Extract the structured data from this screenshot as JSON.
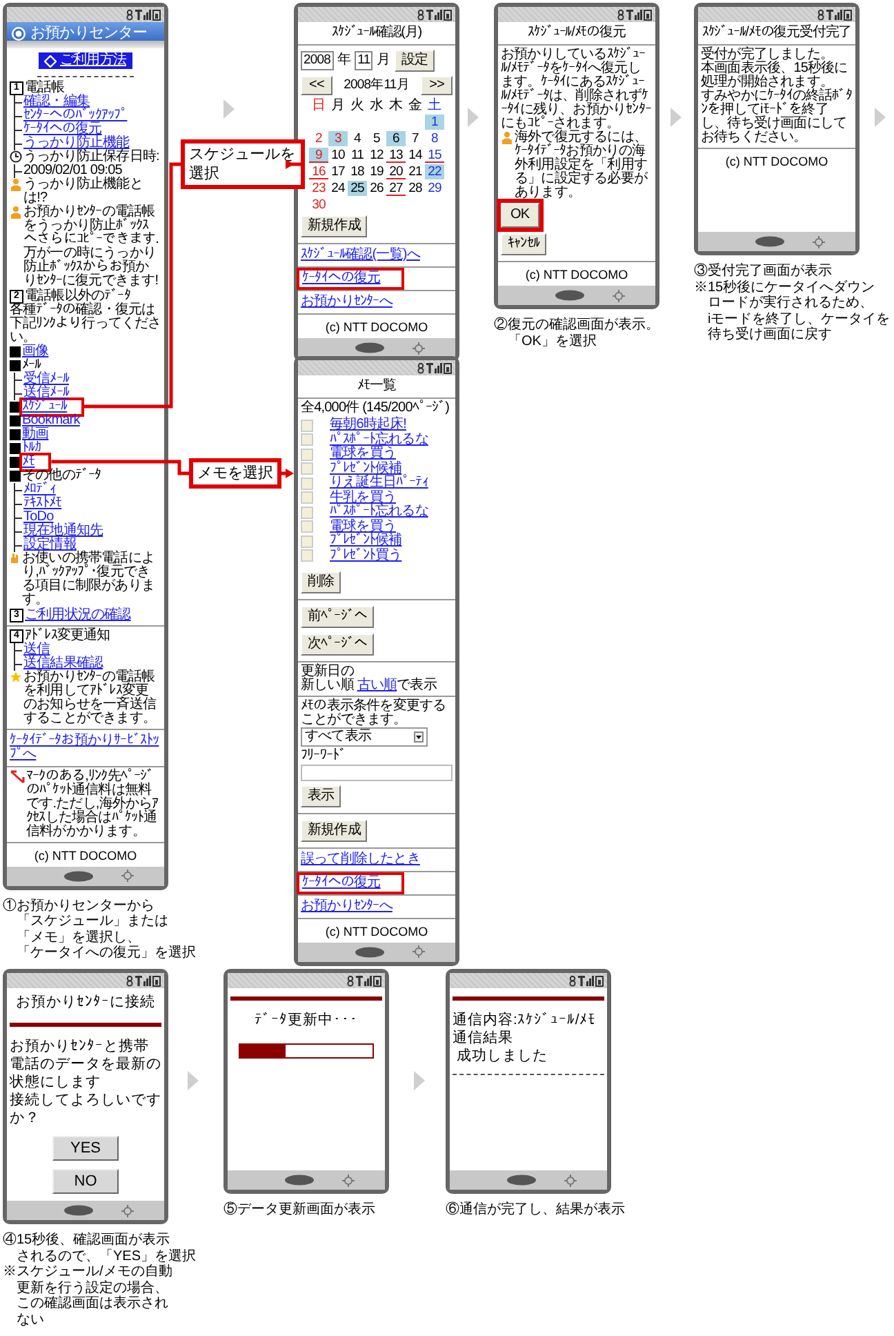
{
  "screens": [
    {
      "blocks": [
        {
          "kind": "title_bar",
          "text": "お預かりセンター"
        },
        {
          "kind": "help_link",
          "text": "ご利用方法"
        },
        {
          "kind": "dashes"
        },
        {
          "kind": "section",
          "num": "1",
          "text": "電話帳",
          "link": false
        },
        {
          "kind": "tree",
          "items": [
            {
              "text": "確認・編集",
              "link": true
            },
            {
              "text": "ｾﾝﾀｰへのﾊﾞｯｸｱｯﾌﾟ",
              "link": true
            },
            {
              "text": "ｹｰﾀｲへの復元",
              "link": true
            },
            {
              "text": "うっかり防止機能",
              "link": true
            }
          ]
        },
        {
          "kind": "clock_note",
          "text": "うっかり防止保存日時:"
        },
        {
          "kind": "tree",
          "items": [
            {
              "text": "2009/02/01 09:05",
              "link": false
            }
          ]
        },
        {
          "kind": "person_note",
          "text": "うっかり防止機能とは!?"
        },
        {
          "kind": "key_note",
          "text": "お預かりｾﾝﾀｰの電話帳をうっかり防止ﾎﾞｯｸｽへさらにｺﾋﾟｰできます.万が一の時にうっかり防止ﾎﾞｯｸｽからお預かりｾﾝﾀｰに復元できます!"
        },
        {
          "kind": "section",
          "num": "2",
          "text": "電話帳以外のﾃﾞｰﾀ",
          "link": false
        },
        {
          "kind": "text",
          "text": "各種ﾃﾞｰﾀの確認・復元は下記ﾘﾝｸより行ってください。"
        },
        {
          "kind": "bullet",
          "text": "画像",
          "link": true,
          "highlighted": false
        },
        {
          "kind": "bullet",
          "text": "ﾒｰﾙ",
          "link": false,
          "highlighted": false
        },
        {
          "kind": "tree",
          "items": [
            {
              "text": "受信ﾒｰﾙ",
              "link": true
            },
            {
              "text": "送信ﾒｰﾙ",
              "link": true
            }
          ]
        },
        {
          "kind": "bullet",
          "text": "ｽｹｼﾞｭｰﾙ",
          "link": true,
          "highlighted": true
        },
        {
          "kind": "bullet",
          "text": "Bookmark",
          "link": true,
          "highlighted": false
        },
        {
          "kind": "bullet",
          "text": "動画",
          "link": true,
          "highlighted": false
        },
        {
          "kind": "bullet",
          "text": "ﾄﾙｶ",
          "link": true,
          "highlighted": false
        },
        {
          "kind": "bullet",
          "text": "ﾒﾓ",
          "link": true,
          "highlighted": true
        },
        {
          "kind": "bullet",
          "text": "その他のﾃﾞｰﾀ",
          "link": false,
          "highlighted": false
        },
        {
          "kind": "tree",
          "items": [
            {
              "text": "ﾒﾛﾃﾞｨ",
              "link": true
            },
            {
              "text": "ﾃｷｽﾄﾒﾓ",
              "link": true
            },
            {
              "text": "ToDo",
              "link": true
            },
            {
              "text": "現在地通知先",
              "link": true
            },
            {
              "text": "設定情報",
              "link": true
            }
          ]
        },
        {
          "kind": "hand_note",
          "text": "お使いの携帯電話により,ﾊﾞｯｸｱｯﾌﾟ･復元できる項目に制限があります。"
        },
        {
          "kind": "section",
          "num": "3",
          "text": "ご利用状況の確認",
          "link": true
        },
        {
          "kind": "divider"
        },
        {
          "kind": "section",
          "num": "4",
          "text": "ｱﾄﾞﾚｽ変更通知",
          "link": false
        },
        {
          "kind": "tree",
          "items": [
            {
              "text": "送信",
              "link": true
            },
            {
              "text": "送信結果確認",
              "link": true
            }
          ]
        },
        {
          "kind": "star_note",
          "text": "お預かりｾﾝﾀｰの電話帳を利用してｱﾄﾞﾚｽ変更のお知らせを一斉送信することができます。"
        },
        {
          "kind": "divider"
        },
        {
          "kind": "link",
          "text": "ｹｰﾀｲﾃﾞｰﾀお預かりｻｰﾋﾞｽﾄｯﾌﾟへ",
          "highlighted": false
        },
        {
          "kind": "divider"
        },
        {
          "kind": "free_note",
          "text": "ﾏｰｸのある,ﾘﾝｸ先ﾍﾟｰｼﾞのﾊﾟｹｯﾄ通信料は無料です.ただし,海外からｱｸｾｽした場合はﾊﾟｹｯﾄ通信料がかかります。"
        },
        {
          "kind": "divider"
        },
        {
          "kind": "footer",
          "text": "(c) NTT DOCOMO"
        }
      ],
      "caption": [
        [
          "①お預かりセンターから",
          "「スケジュール」または",
          "「メモ」を選択し、",
          "「ケータイへの復元」を選択"
        ]
      ]
    },
    {
      "blocks": [
        {
          "kind": "heading",
          "text": "ｽｹｼﾞｭｰﾙ確認(月)"
        },
        {
          "kind": "calendar",
          "year": "2008",
          "year_unit": "年",
          "month": "11",
          "month_unit": "月",
          "set_button": "設定",
          "prev": "<<",
          "next": ">>",
          "caption": "2008年11月",
          "weekdays": [
            "日",
            "月",
            "火",
            "水",
            "木",
            "金",
            "土"
          ],
          "days": [
            {
              "day": "1",
              "marked": true,
              "underlined": false,
              "holiday": false
            },
            {
              "day": "2",
              "marked": false,
              "underlined": false,
              "holiday": true
            },
            {
              "day": "3",
              "marked": true,
              "underlined": false,
              "holiday": true
            },
            {
              "day": "4",
              "marked": false,
              "underlined": false,
              "holiday": false
            },
            {
              "day": "5",
              "marked": false,
              "underlined": false,
              "holiday": false
            },
            {
              "day": "6",
              "marked": true,
              "underlined": false,
              "holiday": false
            },
            {
              "day": "7",
              "marked": false,
              "underlined": false,
              "holiday": false
            },
            {
              "day": "8",
              "marked": false,
              "underlined": false,
              "holiday": false
            },
            {
              "day": "9",
              "marked": true,
              "underlined": true,
              "holiday": true
            },
            {
              "day": "10",
              "marked": false,
              "underlined": false,
              "holiday": false
            },
            {
              "day": "11",
              "marked": false,
              "underlined": false,
              "holiday": false
            },
            {
              "day": "12",
              "marked": false,
              "underlined": false,
              "holiday": false
            },
            {
              "day": "13",
              "marked": false,
              "underlined": true,
              "holiday": false
            },
            {
              "day": "14",
              "marked": false,
              "underlined": false,
              "holiday": false
            },
            {
              "day": "15",
              "marked": false,
              "underlined": true,
              "holiday": false
            },
            {
              "day": "16",
              "marked": false,
              "underlined": true,
              "holiday": true
            },
            {
              "day": "17",
              "marked": false,
              "underlined": false,
              "holiday": false
            },
            {
              "day": "18",
              "marked": false,
              "underlined": false,
              "holiday": false
            },
            {
              "day": "19",
              "marked": false,
              "underlined": false,
              "holiday": false
            },
            {
              "day": "20",
              "marked": false,
              "underlined": true,
              "holiday": false
            },
            {
              "day": "21",
              "marked": false,
              "underlined": false,
              "holiday": false
            },
            {
              "day": "22",
              "marked": true,
              "underlined": false,
              "holiday": false
            },
            {
              "day": "23",
              "marked": false,
              "underlined": false,
              "holiday": true
            },
            {
              "day": "24",
              "marked": false,
              "underlined": false,
              "holiday": false
            },
            {
              "day": "25",
              "marked": true,
              "underlined": false,
              "holiday": false
            },
            {
              "day": "26",
              "marked": false,
              "underlined": false,
              "holiday": false
            },
            {
              "day": "27",
              "marked": false,
              "underlined": true,
              "holiday": false
            },
            {
              "day": "28",
              "marked": false,
              "underlined": false,
              "holiday": false
            },
            {
              "day": "29",
              "marked": false,
              "underlined": false,
              "holiday": false
            },
            {
              "day": "30",
              "marked": false,
              "underlined": false,
              "holiday": true
            }
          ]
        },
        {
          "kind": "button",
          "text": "新規作成",
          "highlighted": false
        },
        {
          "kind": "divider"
        },
        {
          "kind": "link",
          "text": "ｽｹｼﾞｭｰﾙ確認(一覧)へ",
          "highlighted": false
        },
        {
          "kind": "divider"
        },
        {
          "kind": "link",
          "text": "ｹｰﾀｲへの復元",
          "highlighted": true
        },
        {
          "kind": "divider"
        },
        {
          "kind": "link",
          "text": "お預かりｾﾝﾀｰへ",
          "highlighted": false
        },
        {
          "kind": "divider"
        },
        {
          "kind": "footer",
          "text": "(c) NTT DOCOMO"
        }
      ]
    },
    {
      "blocks": [
        {
          "kind": "heading",
          "text": "ﾒﾓ一覧"
        },
        {
          "kind": "text",
          "text": "全4,000件 (145/200ﾍﾟｰｼﾞ)"
        },
        {
          "kind": "checklist",
          "items": [
            {
              "text": "毎朝6時起床!",
              "checked": false
            },
            {
              "text": "ﾊﾟｽﾎﾟｰﾄ忘れるな",
              "checked": false
            },
            {
              "text": "電球を買う",
              "checked": false
            },
            {
              "text": "ﾌﾟﾚｾﾞﾝﾄ候補",
              "checked": false
            },
            {
              "text": "りえ誕生日ﾊﾟｰﾃｨ",
              "checked": false
            },
            {
              "text": "牛乳を買う",
              "checked": false
            },
            {
              "text": "ﾊﾟｽﾎﾟｰﾄ忘れるな",
              "checked": false
            },
            {
              "text": "電球を買う",
              "checked": false
            },
            {
              "text": "ﾌﾟﾚｾﾞﾝﾄ候補",
              "checked": false
            },
            {
              "text": "ﾌﾟﾚｾﾞﾝﾄ買う",
              "checked": false
            }
          ]
        },
        {
          "kind": "button",
          "text": "削除",
          "highlighted": false
        },
        {
          "kind": "divider"
        },
        {
          "kind": "button",
          "text": "前ﾍﾟｰｼﾞへ",
          "highlighted": false
        },
        {
          "kind": "button",
          "text": "次ﾍﾟｰｼﾞへ",
          "highlighted": false
        },
        {
          "kind": "divider"
        },
        {
          "kind": "sort",
          "label": "更新日の",
          "text": "新しい順",
          "link": "古い順",
          "suffix": "で表示"
        },
        {
          "kind": "divider"
        },
        {
          "kind": "text",
          "text": "ﾒﾓの表示条件を変更することができます。"
        },
        {
          "kind": "select",
          "value": "すべて表示"
        },
        {
          "kind": "label",
          "text": "ﾌﾘｰﾜｰﾄﾞ"
        },
        {
          "kind": "input"
        },
        {
          "kind": "button",
          "text": "表示",
          "highlighted": false
        },
        {
          "kind": "divider"
        },
        {
          "kind": "button",
          "text": "新規作成",
          "highlighted": false
        },
        {
          "kind": "divider"
        },
        {
          "kind": "link",
          "text": "誤って削除したとき",
          "highlighted": false
        },
        {
          "kind": "divider"
        },
        {
          "kind": "link",
          "text": "ｹｰﾀｲへの復元",
          "highlighted": true
        },
        {
          "kind": "divider"
        },
        {
          "kind": "link",
          "text": "お預かりｾﾝﾀｰへ",
          "highlighted": false
        },
        {
          "kind": "divider"
        },
        {
          "kind": "footer",
          "text": "(c) NTT DOCOMO"
        }
      ]
    },
    {
      "blocks": [
        {
          "kind": "heading",
          "text": "ｽｹｼﾞｭｰﾙ/ﾒﾓの復元"
        },
        {
          "kind": "text",
          "text": "お預かりしているｽｹｼﾞｭｰﾙ/ﾒﾓﾃﾞｰﾀをｹｰﾀｲへ復元します。ｹｰﾀｲにあるｽｹｼﾞｭｰﾙ/ﾒﾓﾃﾞｰﾀは、削除されずｹｰﾀｲに残り、お預かりｾﾝﾀｰにもｺﾋﾟｰされます。"
        },
        {
          "kind": "person_note",
          "text": "海外で復元するには、ｹｰﾀｲﾃﾞｰﾀお預かりの海外利用設定を「利用する」に設定する必要があります。"
        },
        {
          "kind": "button",
          "text": "OK",
          "highlighted": true
        },
        {
          "kind": "button",
          "text": "ｷｬﾝｾﾙ",
          "highlighted": false
        },
        {
          "kind": "divider"
        },
        {
          "kind": "footer",
          "text": "(c) NTT DOCOMO"
        }
      ],
      "caption": [
        [
          "②復元の確認画面が表示。",
          "「OK」を選択"
        ]
      ]
    },
    {
      "blocks": [
        {
          "kind": "heading",
          "text": "ｽｹｼﾞｭｰﾙ/ﾒﾓの復元受付完了"
        },
        {
          "kind": "text",
          "text": "受付が完了しました。"
        },
        {
          "kind": "text",
          "text": "本画面表示後、15秒後に処理が開始されます。"
        },
        {
          "kind": "text",
          "text": "すみやかにｹｰﾀｲの終話ﾎﾞﾀﾝを押してiﾓｰﾄﾞを終了し、待ち受け画面にしてお待ちください。"
        },
        {
          "kind": "divider"
        },
        {
          "kind": "footer",
          "text": "(c) NTT DOCOMO"
        }
      ],
      "caption": [
        [
          "③受付完了画面が表示"
        ],
        [
          "※15秒後にケータイへダウン",
          "ロードが実行されるため、",
          "iモードを終了し、ケータイを",
          "待ち受け画面に戻す"
        ]
      ]
    },
    {
      "blocks": [
        {
          "kind": "heading",
          "text": "お預かりｾﾝﾀｰに接続"
        },
        {
          "kind": "rule"
        },
        {
          "kind": "text",
          "text": "お預かりｾﾝﾀｰと携帯電話のデータを最新の状態にします"
        },
        {
          "kind": "text",
          "text": "接続してよろしいですか？"
        },
        {
          "kind": "wide_button",
          "text": "YES"
        },
        {
          "kind": "wide_button",
          "text": "NO"
        }
      ],
      "caption": [
        [
          "④15秒後、確認画面が表示",
          "されるので、「YES」を選択"
        ],
        [
          "※スケジュール/メモの自動",
          "更新を行う設定の場合、",
          "この確認画面は表示され",
          "ない"
        ]
      ]
    },
    {
      "blocks": [
        {
          "kind": "rule"
        },
        {
          "kind": "status_text",
          "text": "ﾃﾞｰﾀ更新中･･･"
        },
        {
          "kind": "progress",
          "level": 0.34
        }
      ],
      "caption": [
        [
          "⑤データ更新画面が表示"
        ]
      ]
    },
    {
      "blocks": [
        {
          "kind": "rule"
        },
        {
          "kind": "text",
          "text": "通信内容:ｽｹｼﾞｭｰﾙ/ﾒﾓ"
        },
        {
          "kind": "text",
          "text": "通信結果"
        },
        {
          "kind": "text",
          "text": " 成功しました"
        },
        {
          "kind": "dashes"
        }
      ],
      "caption": [
        [
          "⑥通信が完了し、結果が表示"
        ]
      ]
    }
  ],
  "callouts": [
    {
      "text": "スケジュールを選択"
    },
    {
      "text": "メモを選択"
    }
  ]
}
